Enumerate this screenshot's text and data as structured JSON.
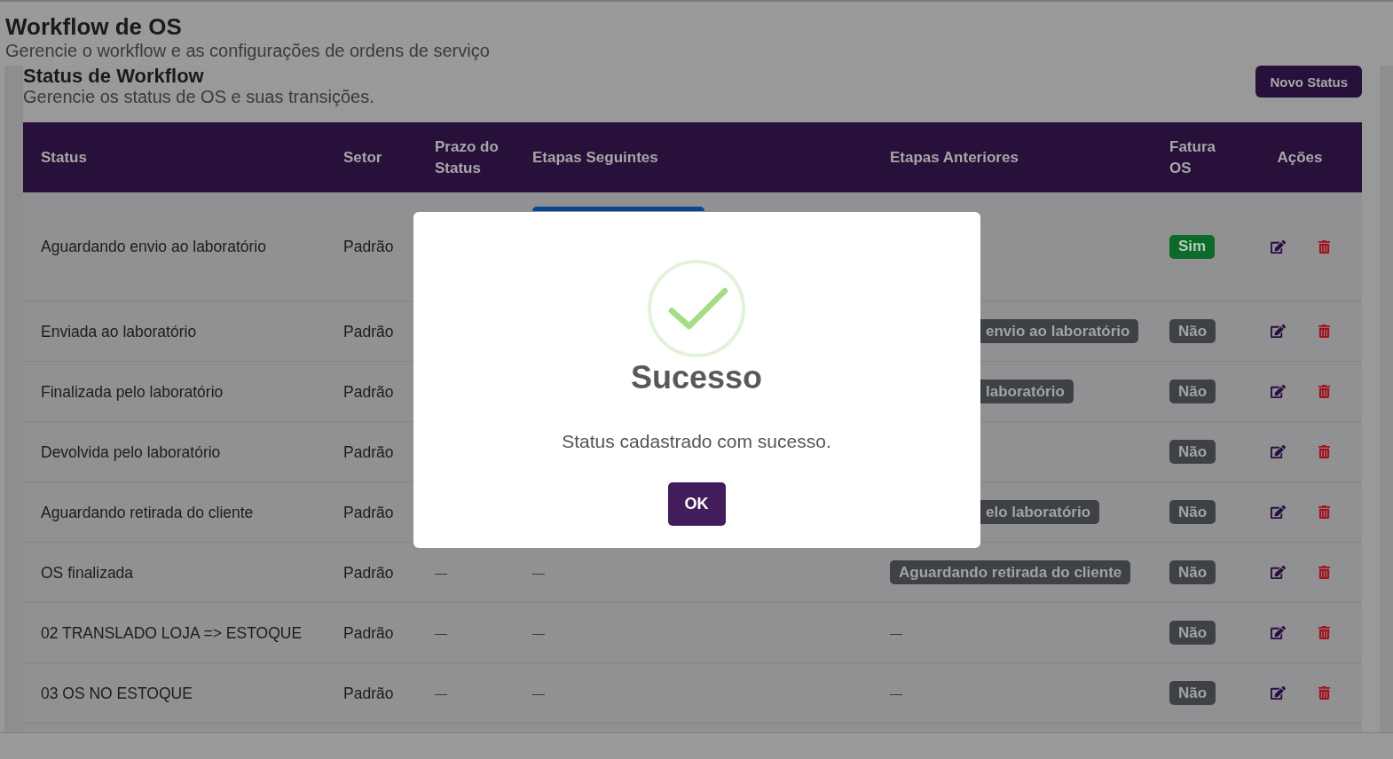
{
  "page": {
    "title": "Workflow de OS",
    "subtitle": "Gerencie o workflow e as configurações de ordens de serviço"
  },
  "section": {
    "title": "Status de Workflow",
    "subtitle": "Gerencie os status de OS e suas transições.",
    "new_button": "Novo Status"
  },
  "table": {
    "columns": [
      "Status",
      "Setor",
      "Prazo do Status",
      "Etapas Seguintes",
      "Etapas Anteriores",
      "Fatura OS",
      "Ações"
    ],
    "rows": [
      {
        "status": "Aguardando envio ao laboratório",
        "setor": "Padrão",
        "next_peek": true,
        "fatura": {
          "label": "Sim",
          "on": true
        }
      },
      {
        "status": "Enviada ao laboratório",
        "setor": "Padrão",
        "previous": {
          "kind": "tag",
          "text": "envio ao laboratório",
          "cut": true
        },
        "fatura": {
          "label": "Não",
          "on": false
        }
      },
      {
        "status": "Finalizada pelo laboratório",
        "setor": "Padrão",
        "previous": {
          "kind": "tag",
          "text": "laboratório",
          "cut": true
        },
        "fatura": {
          "label": "Não",
          "on": false
        }
      },
      {
        "status": "Devolvida pelo laboratório",
        "setor": "Padrão",
        "fatura": {
          "label": "Não",
          "on": false
        }
      },
      {
        "status": "Aguardando retirada do cliente",
        "setor": "Padrão",
        "previous": {
          "kind": "tag",
          "text": "elo laboratório",
          "cut": true
        },
        "fatura": {
          "label": "Não",
          "on": false
        }
      },
      {
        "status": "OS finalizada",
        "setor": "Padrão",
        "prazo": "—",
        "next": {
          "kind": "text",
          "text": "—"
        },
        "previous": {
          "kind": "tag",
          "text": "Aguardando retirada do cliente",
          "cut": false
        },
        "fatura": {
          "label": "Não",
          "on": false
        }
      },
      {
        "status": "02 TRANSLADO LOJA => ESTOQUE",
        "setor": "Padrão",
        "prazo": "—",
        "next": {
          "kind": "text",
          "text": "—"
        },
        "previous": {
          "kind": "text",
          "text": "—"
        },
        "fatura": {
          "label": "Não",
          "on": false
        }
      },
      {
        "status": "03 OS NO ESTOQUE",
        "setor": "Padrão",
        "prazo": "—",
        "next": {
          "kind": "text",
          "text": "—"
        },
        "previous": {
          "kind": "text",
          "text": "—"
        },
        "fatura": {
          "label": "Não",
          "on": false
        }
      }
    ]
  },
  "dialog": {
    "title": "Sucesso",
    "message": "Status cadastrado com sucesso.",
    "button": "OK"
  }
}
